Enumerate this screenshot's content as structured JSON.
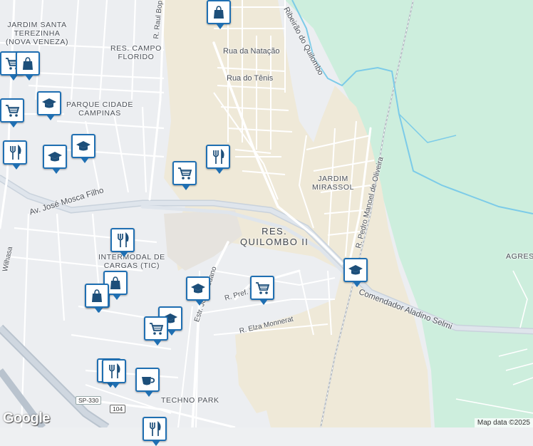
{
  "map": {
    "areas": [
      {
        "id": "jardim-santa-terezinha",
        "lines": [
          "JARDIM SANTA",
          "TEREZINHA",
          "(NOVA VENEZA)"
        ]
      },
      {
        "id": "res-campo-florido",
        "lines": [
          "RES. CAMPO",
          "FLORIDO"
        ]
      },
      {
        "id": "parque-cidade-campinas",
        "lines": [
          "PARQUE CIDADE",
          "CAMPINAS"
        ]
      },
      {
        "id": "jardim-mirassol",
        "lines": [
          "JARDIM",
          "MIRASSOL"
        ]
      },
      {
        "id": "res-quilombo-ii",
        "lines": [
          "RES.",
          "QUILOMBO II"
        ]
      },
      {
        "id": "terminal-cargas",
        "lines": [
          "INTERMODAL DE",
          "CARGAS (TIC)"
        ]
      },
      {
        "id": "techno-park",
        "lines": [
          "TECHNO PARK"
        ]
      },
      {
        "id": "agrest",
        "lines": [
          "AGREST"
        ]
      }
    ],
    "roads": {
      "raul_bop": "R. Raul Bop",
      "natacao": "Rua da Natação",
      "tenis": "Rua do Tênis",
      "jose_mosca": "Av. José Mosca Filho",
      "quilombo": "Ribeirão do Quilombo",
      "pedro_manoel": "R. Pedro Manoel de Oliveira",
      "comendador": "Comendador Aladino Selmi",
      "sedano": "Estr. José Sedano",
      "pref": "R. Pref. Daniel",
      "elza": "R. Elza Monnerat",
      "sp330": "SP-330",
      "r104": "104",
      "wilhasa": "Wilhasa"
    },
    "pins": [
      {
        "icon": "shopping-bag-icon",
        "name": "pin-shopping-top"
      },
      {
        "icon": "shopping-cart-icon",
        "name": "pin-cart-left-1"
      },
      {
        "icon": "shopping-bag-icon",
        "name": "pin-bag-left-1"
      },
      {
        "icon": "school-icon",
        "name": "pin-school-left-1"
      },
      {
        "icon": "shopping-cart-icon",
        "name": "pin-cart-left-2"
      },
      {
        "icon": "school-icon",
        "name": "pin-school-left-2"
      },
      {
        "icon": "school-icon",
        "name": "pin-school-left-3"
      },
      {
        "icon": "shopping-bag-icon",
        "name": "pin-bag-left-2"
      },
      {
        "icon": "restaurant-icon",
        "name": "pin-restaurant-left"
      },
      {
        "icon": "restaurant-icon",
        "name": "pin-restaurant-center"
      },
      {
        "icon": "shopping-cart-icon",
        "name": "pin-cart-center"
      },
      {
        "icon": "restaurant-icon",
        "name": "pin-restaurant-tic"
      },
      {
        "icon": "shopping-bag-icon",
        "name": "pin-bag-tic-1"
      },
      {
        "icon": "shopping-bag-icon",
        "name": "pin-bag-tic-2"
      },
      {
        "icon": "school-icon",
        "name": "pin-school-sedano"
      },
      {
        "icon": "shopping-cart-icon",
        "name": "pin-cart-daniel"
      },
      {
        "icon": "school-icon",
        "name": "pin-school-elza"
      },
      {
        "icon": "shopping-cart-icon",
        "name": "pin-cart-elza"
      },
      {
        "icon": "school-icon",
        "name": "pin-school-mirassol"
      },
      {
        "icon": "restaurant-icon",
        "name": "pin-restaurant-techno-1"
      },
      {
        "icon": "restaurant-icon",
        "name": "pin-restaurant-techno-2"
      },
      {
        "icon": "cafe-icon",
        "name": "pin-cafe-techno"
      },
      {
        "icon": "restaurant-icon",
        "name": "pin-restaurant-bottom"
      }
    ],
    "logo": "Google",
    "attribution": "Map data ©2025"
  },
  "colors": {
    "land": "#eef0f2",
    "urban": "#e8eaed",
    "sand": "#efe9d8",
    "green": "#cfeedd",
    "road": "#ffffff",
    "highway": "#d5dde6",
    "water": "#7ccbe8",
    "pin_border": "#1f6fb2",
    "pin_icon": "#1d4f7a"
  }
}
